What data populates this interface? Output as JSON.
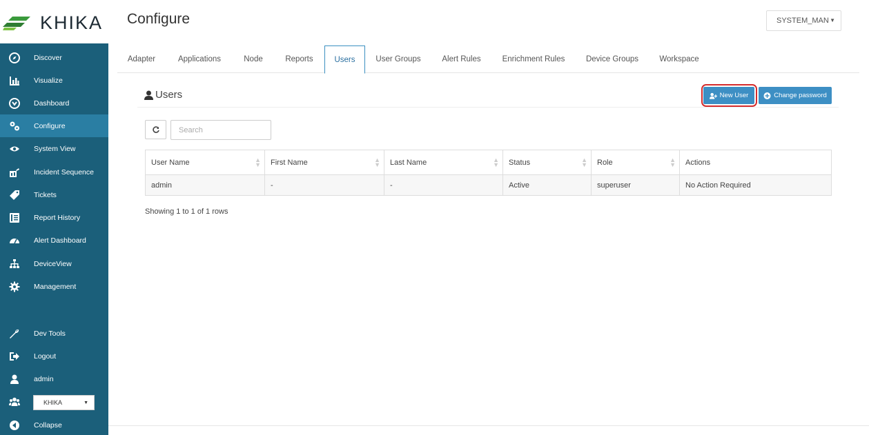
{
  "brand": {
    "name": "KHIKA"
  },
  "header": {
    "title": "Configure",
    "system_select": "SYSTEM_MAN"
  },
  "sidebar": {
    "items": [
      {
        "label": "Discover",
        "icon": "compass-icon"
      },
      {
        "label": "Visualize",
        "icon": "bar-chart-icon"
      },
      {
        "label": "Dashboard",
        "icon": "dashboard-icon"
      },
      {
        "label": "Configure",
        "icon": "cogs-icon",
        "active": true
      },
      {
        "label": "System View",
        "icon": "eye-icon"
      },
      {
        "label": "Incident Sequence",
        "icon": "incident-icon"
      },
      {
        "label": "Tickets",
        "icon": "tag-icon"
      },
      {
        "label": "Report History",
        "icon": "list-icon"
      },
      {
        "label": "Alert Dashboard",
        "icon": "tachometer-icon"
      },
      {
        "label": "DeviceView",
        "icon": "sitemap-icon"
      },
      {
        "label": "Management",
        "icon": "gear-icon"
      },
      {
        "label": "Dev Tools",
        "icon": "wrench-icon"
      },
      {
        "label": "Logout",
        "icon": "sign-out-icon"
      },
      {
        "label": "admin",
        "icon": "user-icon"
      },
      {
        "label": "",
        "icon": "users-icon"
      },
      {
        "label": "Collapse",
        "icon": "collapse-icon"
      }
    ],
    "tenant_select": "KHIKA"
  },
  "tabs": [
    "Adapter",
    "Applications",
    "Node",
    "Reports",
    "Users",
    "User Groups",
    "Alert Rules",
    "Enrichment Rules",
    "Device Groups",
    "Workspace"
  ],
  "active_tab": "Users",
  "panel": {
    "title": "Users",
    "new_user_label": "New User",
    "change_password_label": "Change password"
  },
  "search": {
    "placeholder": "Search",
    "value": ""
  },
  "table": {
    "headers": [
      "User Name",
      "First Name",
      "Last Name",
      "Status",
      "Role",
      "Actions"
    ],
    "rows": [
      [
        "admin",
        "-",
        "-",
        "Active",
        "superuser",
        "No Action Required"
      ]
    ]
  },
  "footer": {
    "showing": "Showing 1 to 1 of 1 rows"
  },
  "colors": {
    "sidebar_bg": "#1b5f7a",
    "sidebar_active": "#2a7ea3",
    "accent": "#3d8fc4",
    "highlight": "#d42b2b"
  }
}
